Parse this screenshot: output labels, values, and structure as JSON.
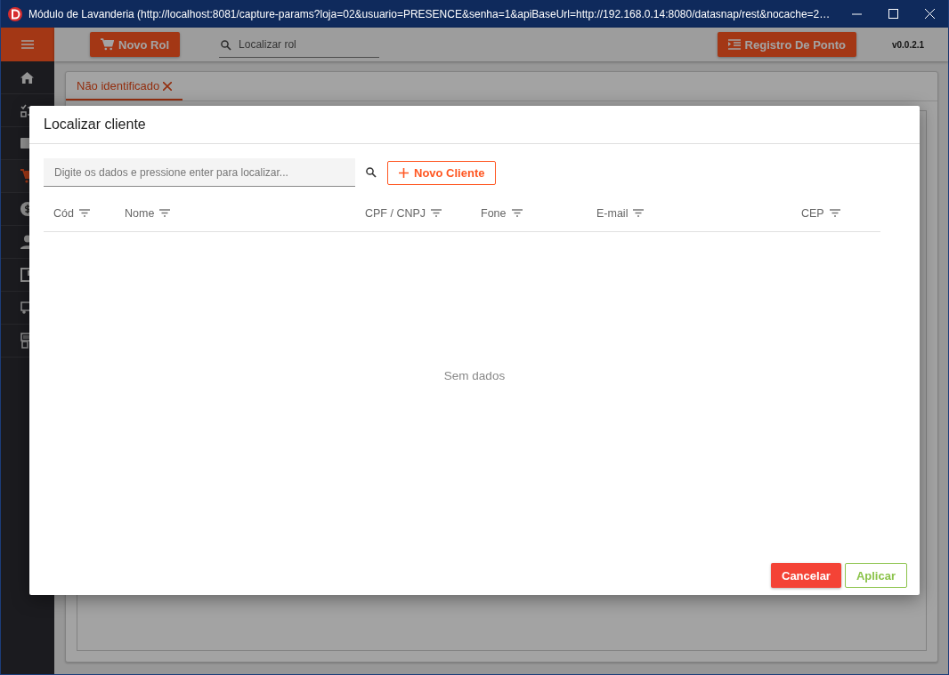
{
  "window": {
    "title": "Módulo de Lavanderia (http://localhost:8081/capture-params?loja=02&usuario=PRESENCE&senha=1&apiBaseUrl=http://192.168.0.14:8080/datasnap/rest&nocache=2…"
  },
  "sidebar": {
    "items": [
      {
        "selected": false
      },
      {
        "selected": false
      },
      {
        "selected": false
      },
      {
        "selected": true
      },
      {
        "selected": false
      },
      {
        "selected": false
      },
      {
        "selected": false
      },
      {
        "selected": false
      },
      {
        "selected": false
      }
    ]
  },
  "toolbar": {
    "new_button": "Novo Rol",
    "search": {
      "placeholder": "Localizar rol"
    },
    "timeclock_button": "Registro De Ponto",
    "version": "v0.0.2.1"
  },
  "tabs": [
    {
      "label": "Não identificado",
      "selected": true
    }
  ],
  "dialog": {
    "title": "Localizar cliente",
    "search": {
      "placeholder": "Digite os dados e pressione enter para localizar..."
    },
    "new_button": "Novo Cliente",
    "columns": [
      "Cód",
      "Nome",
      "CPF / CNPJ",
      "Fone",
      "E-mail",
      "CEP"
    ],
    "empty_text": "Sem dados",
    "buttons": [
      {
        "label": "Cancelar",
        "kind": "primary"
      },
      {
        "label": "Aplicar",
        "kind": "outline"
      }
    ]
  }
}
